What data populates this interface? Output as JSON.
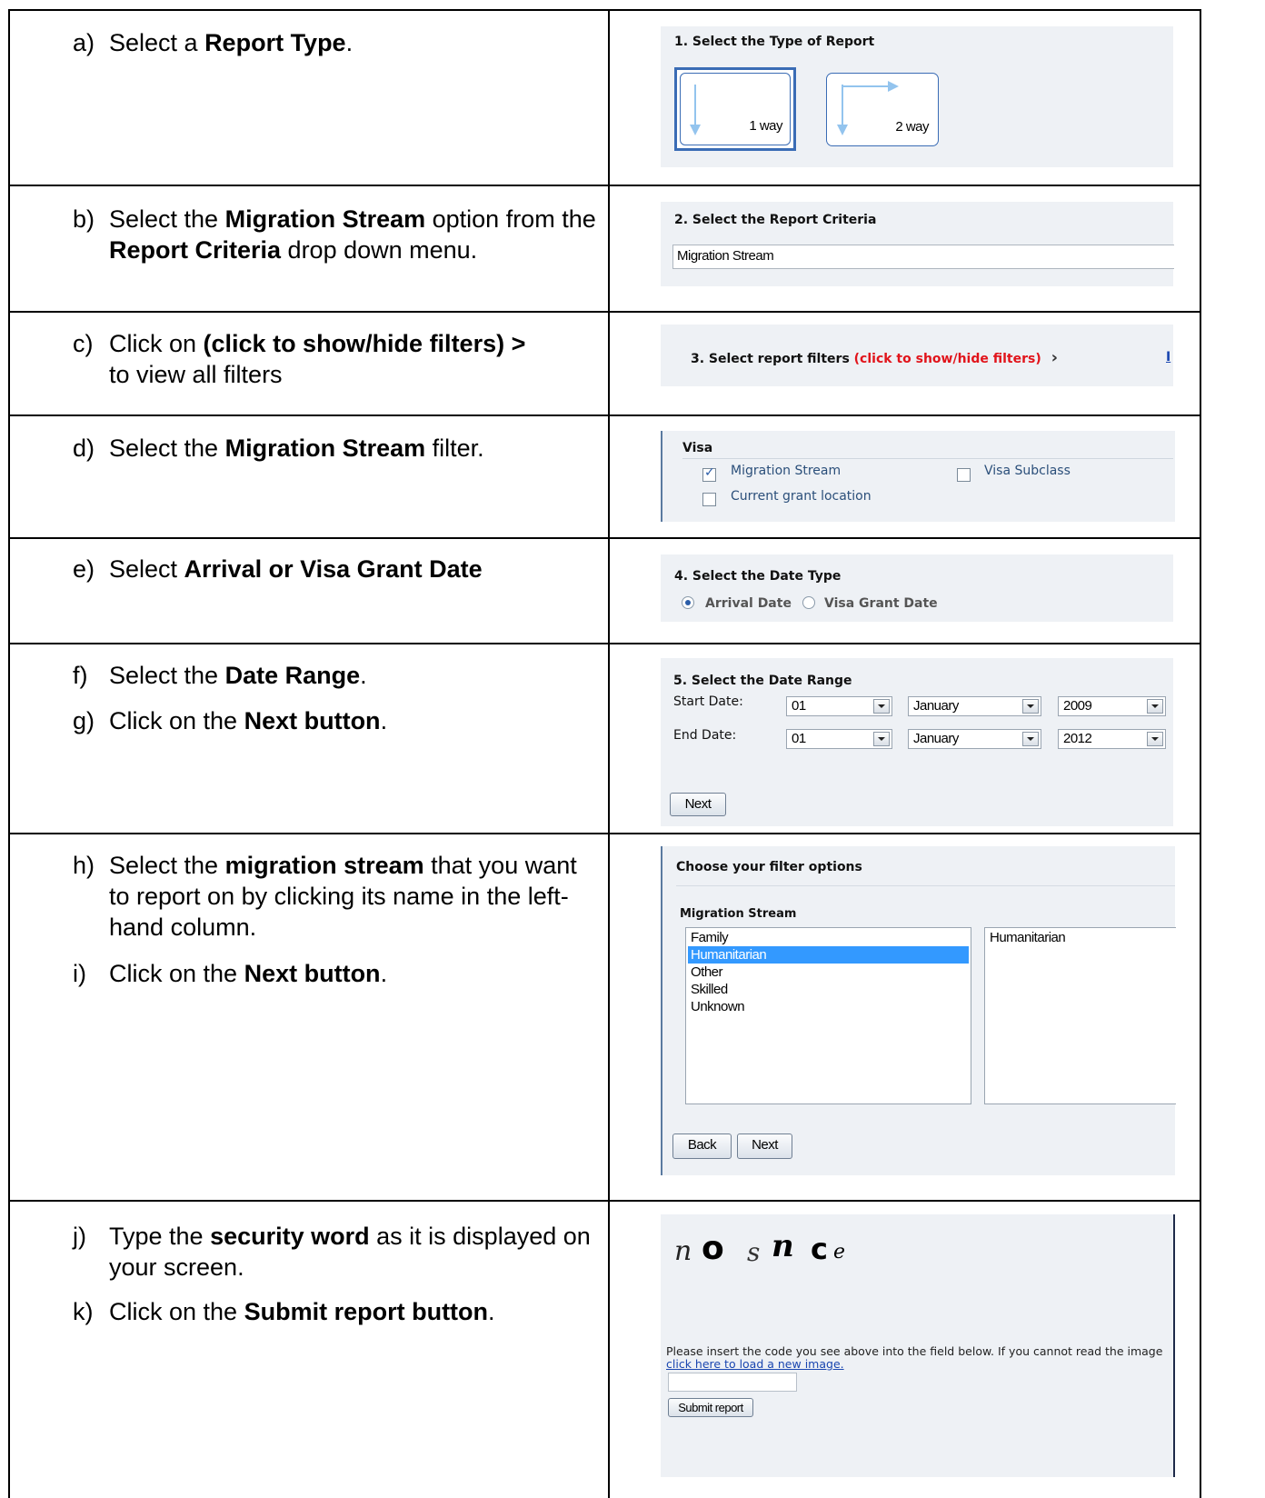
{
  "steps": {
    "a": {
      "marker": "a)",
      "t1": "Select a ",
      "b1": "Report Type",
      "t2": "."
    },
    "b": {
      "marker": "b)",
      "t1": "Select the ",
      "b1": "Migration Stream",
      "t2": " option from the ",
      "b2": "Report Criteria",
      "t3": " drop down menu."
    },
    "c": {
      "marker": "c)",
      "t1": "Click on ",
      "b1": "(click to show/hide filters) >",
      "t2": " to view all filters"
    },
    "d": {
      "marker": "d)",
      "t1": "Select the ",
      "b1": "Migration Stream",
      "t2": " filter."
    },
    "e": {
      "marker": "e)",
      "t1": "Select ",
      "b1": "Arrival or Visa Grant Date"
    },
    "f": {
      "marker": "f)",
      "t1": "Select the ",
      "b1": "Date Range",
      "t2": "."
    },
    "g": {
      "marker": "g)",
      "t1": "Click on the ",
      "b1": "Next button",
      "t2": "."
    },
    "h": {
      "marker": "h)",
      "t1": "Select the ",
      "b1": "migration stream",
      "t2": " that you want to report on by clicking its name in the left-hand column."
    },
    "i": {
      "marker": "i)",
      "t1": "Click on the ",
      "b1": "Next button",
      "t2": "."
    },
    "j": {
      "marker": "j)",
      "t1": "Type the ",
      "b1": "security word",
      "t2": " as it is displayed on your screen."
    },
    "k": {
      "marker": "k)",
      "t1": "Click on the ",
      "b1": "Submit report button",
      "t2": "."
    }
  },
  "s1": {
    "heading": "1. Select the Type of Report",
    "opt1": "1 way",
    "opt2": "2 way"
  },
  "s2": {
    "heading": "2. Select the Report Criteria",
    "value": "Migration Stream"
  },
  "s3": {
    "heading": "3. Select report filters ",
    "link": "(click to show/hide filters)",
    "chevron": "›",
    "edge": "I"
  },
  "s4": {
    "group": "Visa",
    "cb1": "Migration Stream",
    "cb2": "Visa Subclass",
    "cb3": "Current grant location",
    "check": "✓"
  },
  "s5": {
    "heading": "4. Select the Date Type",
    "r1": "Arrival Date",
    "r2": "Visa Grant Date"
  },
  "s6": {
    "heading": "5. Select the Date Range",
    "start_label": "Start Date:",
    "end_label": "End Date:",
    "start": {
      "day": "01",
      "month": "January",
      "year": "2009"
    },
    "end": {
      "day": "01",
      "month": "January",
      "year": "2012"
    },
    "next": "Next"
  },
  "s7": {
    "heading": "Choose your filter options",
    "sub": "Migration Stream",
    "available": [
      "Family",
      "Humanitarian",
      "Other",
      "Skilled",
      "Unknown"
    ],
    "selected_item": "Humanitarian",
    "back": "Back",
    "next": "Next"
  },
  "s8": {
    "captcha": [
      "n",
      "o",
      "s",
      "n",
      "c",
      "e"
    ],
    "msg": "Please insert the code you see above into the field below. If you cannot read the image ",
    "link": "click here to load a new image.",
    "submit": "Submit report"
  }
}
